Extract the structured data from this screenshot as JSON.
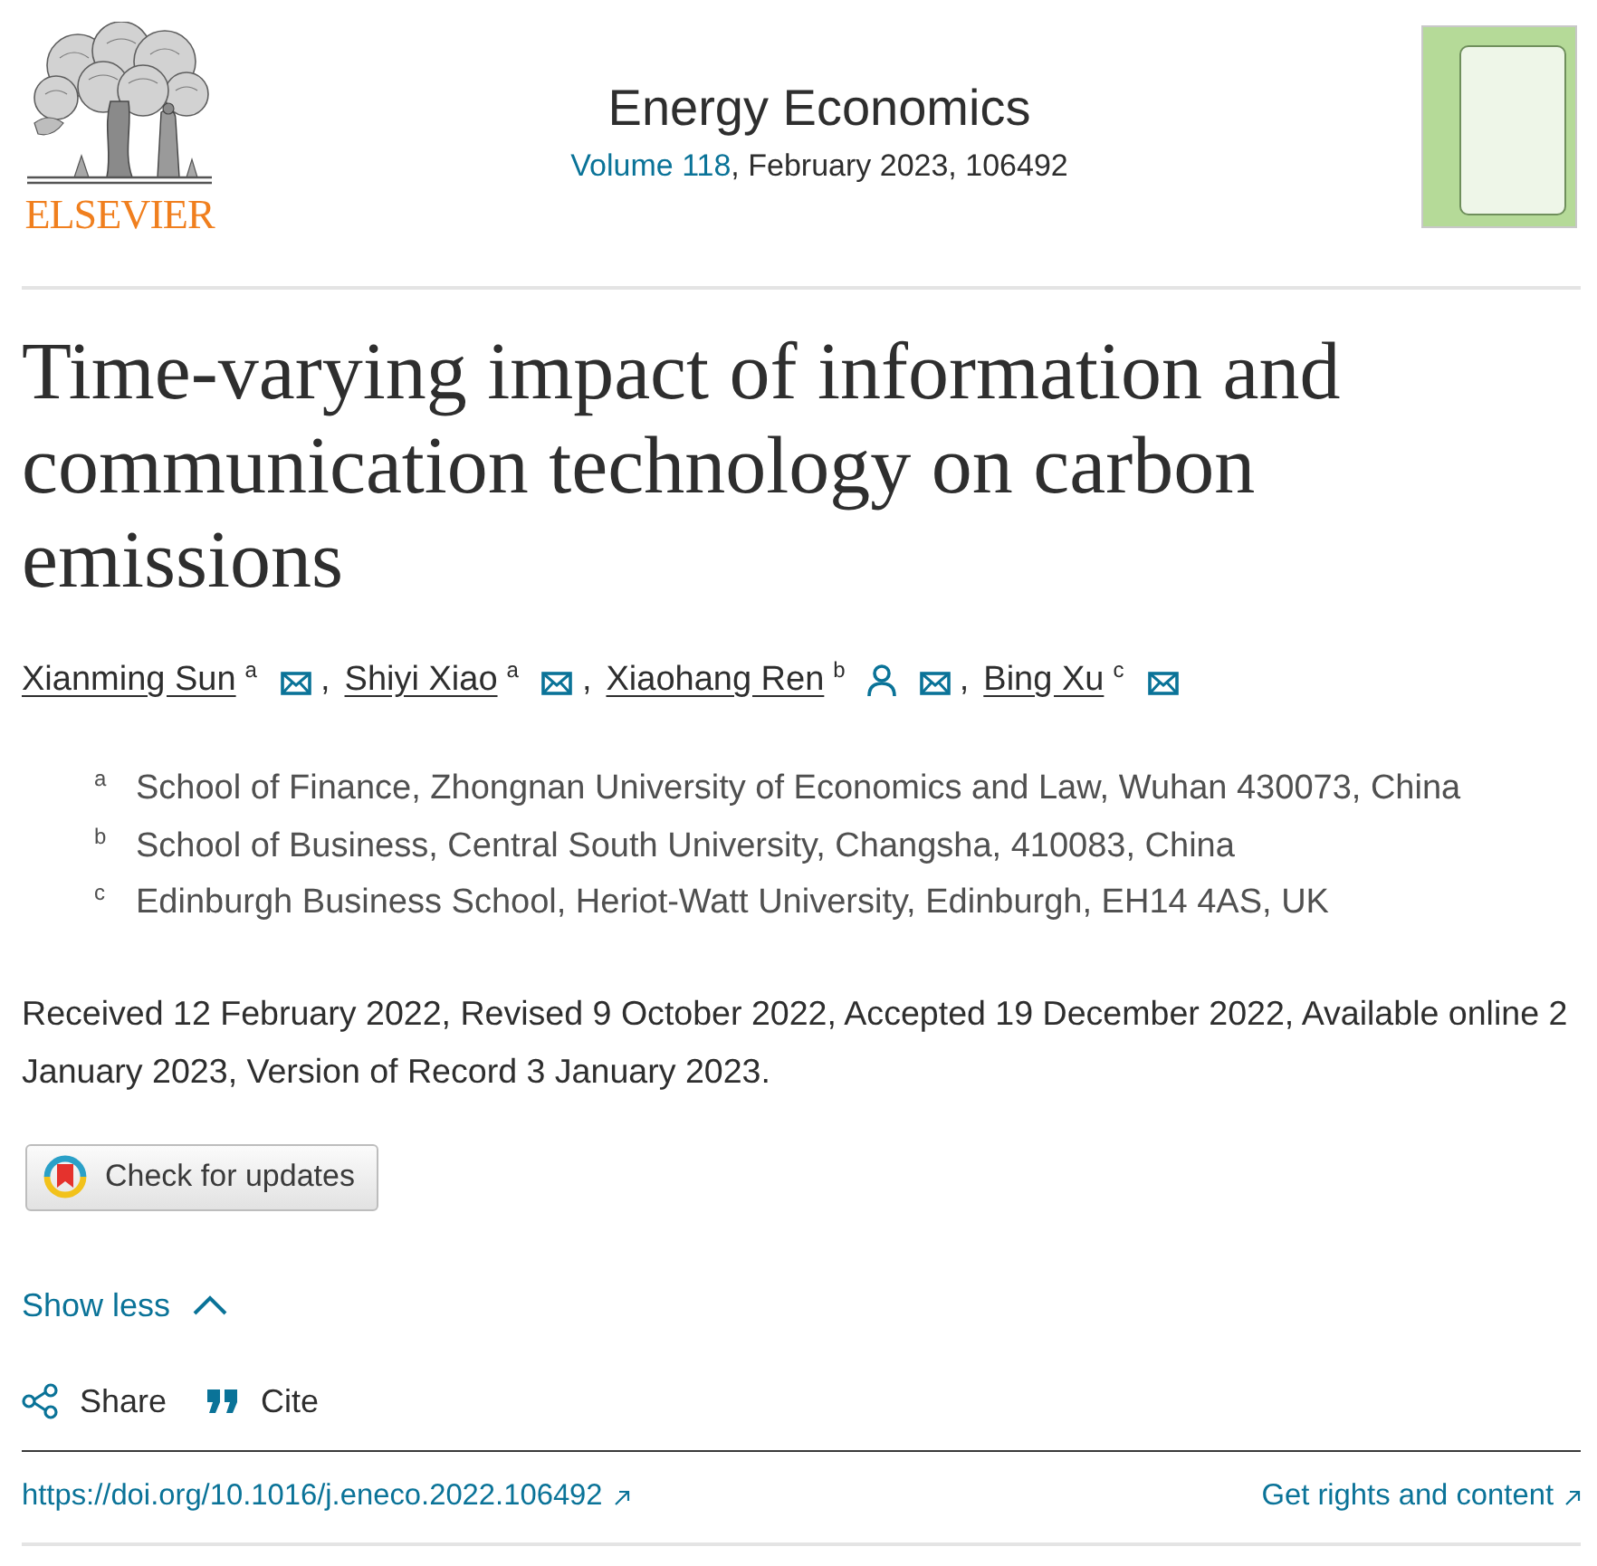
{
  "header": {
    "publisher": "ELSEVIER",
    "journal_title": "Energy Economics",
    "volume_link": "Volume 118",
    "issue_details": ", February 2023, 106492"
  },
  "article": {
    "title": "Time-varying impact of information and communication technology on carbon emissions",
    "authors": [
      {
        "name": "Xianming Sun",
        "affiliation": "a",
        "corresponding": false,
        "separator": ","
      },
      {
        "name": "Shiyi Xiao",
        "affiliation": "a",
        "corresponding": false,
        "separator": ","
      },
      {
        "name": "Xiaohang Ren",
        "affiliation": "b",
        "corresponding": true,
        "separator": ","
      },
      {
        "name": "Bing Xu",
        "affiliation": "c",
        "corresponding": false
      }
    ],
    "affiliations": [
      {
        "label": "a",
        "text": "School of Finance, Zhongnan University of Economics and Law, Wuhan 430073, China"
      },
      {
        "label": "b",
        "text": "School of Business, Central South University, Changsha, 410083, China"
      },
      {
        "label": "c",
        "text": "Edinburgh Business School, Heriot-Watt University, Edinburgh, EH14 4AS, UK"
      }
    ],
    "history": "Received 12 February 2022, Revised 9 October 2022, Accepted 19 December 2022, Available online 2 January 2023, Version of Record 3 January 2023.",
    "check_for_updates": "Check for updates",
    "toggle": {
      "label": "Show less",
      "expanded": true
    },
    "actions": [
      {
        "label": "Share",
        "kind": "share"
      },
      {
        "label": "Cite",
        "kind": "cite"
      }
    ],
    "doi": "https://doi.org/10.1016/j.eneco.2022.106492",
    "rights_link": "Get rights and content"
  }
}
